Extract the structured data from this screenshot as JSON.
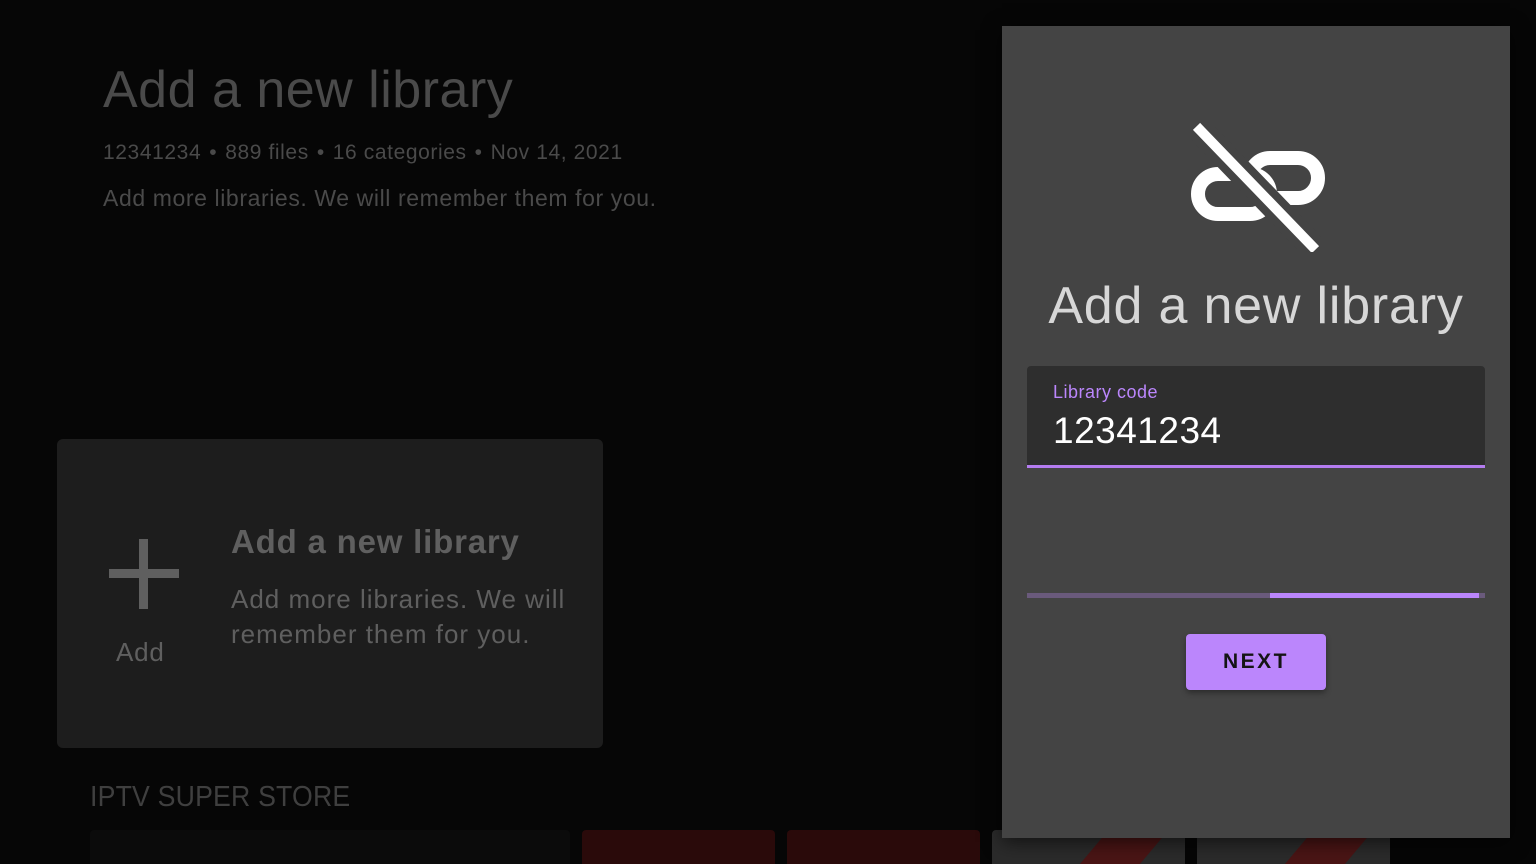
{
  "background": {
    "title": "Add a new library",
    "meta": {
      "code": "12341234",
      "files": "889 files",
      "categories": "16 categories",
      "date": "Nov 14, 2021",
      "separator": "•"
    },
    "description": "Add more libraries. We will remember them for you.",
    "card": {
      "add_label": "Add",
      "title": "Add a new library",
      "description": "Add more libraries. We will remember them for you."
    },
    "store_label": "IPTV SUPER STORE"
  },
  "dialog": {
    "icon": "link-off-icon",
    "title": "Add a new library",
    "field": {
      "label": "Library code",
      "value": "12341234"
    },
    "progress": 0.53,
    "next_label": "NEXT"
  },
  "colors": {
    "accent": "#bb86fc",
    "dialog_bg": "#444444",
    "field_bg": "#2e2e2e"
  }
}
